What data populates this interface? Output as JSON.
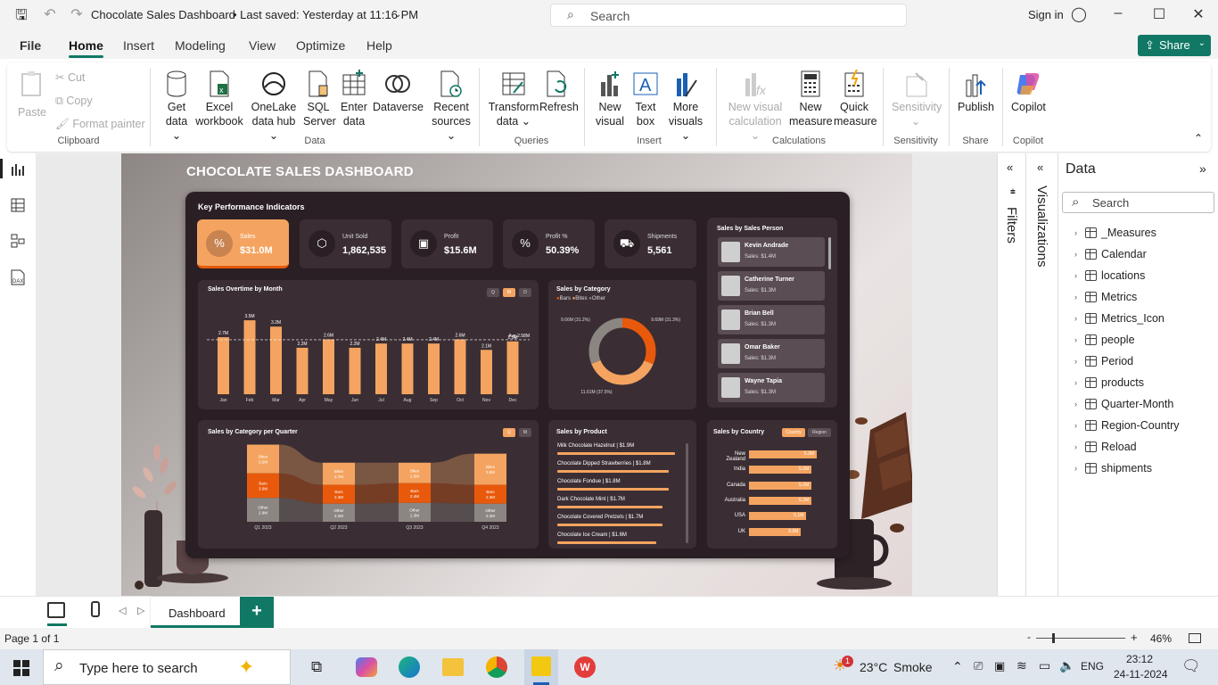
{
  "titlebar": {
    "doc_title": "Chocolate Sales Dashboard",
    "saved": "• Last saved: Yesterday at 11:16 PM",
    "search_placeholder": "Search",
    "sign_in": "Sign in"
  },
  "menu": {
    "file": "File",
    "items": [
      "Home",
      "Insert",
      "Modeling",
      "View",
      "Optimize",
      "Help"
    ],
    "share": "Share"
  },
  "ribbon": {
    "clipboard": {
      "paste": "Paste",
      "cut": "Cut",
      "copy": "Copy",
      "format_painter": "Format painter",
      "group": "Clipboard"
    },
    "data": {
      "get_data": [
        "Get",
        "data ⌄"
      ],
      "excel": [
        "Excel",
        "workbook"
      ],
      "onelake": [
        "OneLake",
        "data hub ⌄"
      ],
      "sql": [
        "SQL",
        "Server"
      ],
      "enter": [
        "Enter",
        "data"
      ],
      "dataverse": [
        "Dataverse",
        ""
      ],
      "recent": [
        "Recent",
        "sources ⌄"
      ],
      "group": "Data"
    },
    "queries": {
      "transform": [
        "Transform",
        "data ⌄"
      ],
      "refresh": [
        "Refresh",
        ""
      ],
      "group": "Queries"
    },
    "insert": {
      "new_visual": [
        "New",
        "visual"
      ],
      "text_box": [
        "Text",
        "box"
      ],
      "more_visuals": [
        "More",
        "visuals ⌄"
      ],
      "group": "Insert"
    },
    "calculations": {
      "new_visual_calc": [
        "New visual",
        "calculation ⌄"
      ],
      "new_measure": [
        "New",
        "measure"
      ],
      "quick_measure": [
        "Quick",
        "measure"
      ],
      "group": "Calculations"
    },
    "sensitivity": {
      "label": [
        "Sensitivity",
        "⌄"
      ],
      "group": "Sensitivity"
    },
    "share": {
      "publish": "Publish",
      "group": "Share"
    },
    "copilot": {
      "label": "Copilot",
      "group": "Copilot"
    }
  },
  "report": {
    "title": "CHOCOLATE SALES DASHBOARD",
    "kpi_title": "Key Performance Indicators",
    "kpis": [
      {
        "label": "Sales",
        "value": "$31.0M",
        "icon": "%"
      },
      {
        "label": "Unit Sold",
        "value": "1,862,535",
        "icon": "⬡"
      },
      {
        "label": "Profit",
        "value": "$15.6M",
        "icon": "▣"
      },
      {
        "label": "Profit %",
        "value": "50.39%",
        "icon": "%"
      },
      {
        "label": "Shipments",
        "value": "5,561",
        "icon": "⛟"
      }
    ],
    "salesperson_title": "Sales by Sales Person",
    "salespersons": [
      {
        "name": "Kevin Andrade",
        "sales": "Sales: $1.4M"
      },
      {
        "name": "Catherine Turner",
        "sales": "Sales: $1.3M"
      },
      {
        "name": "Brian Bell",
        "sales": "Sales: $1.3M"
      },
      {
        "name": "Omar Baker",
        "sales": "Sales: $1.3M"
      },
      {
        "name": "Wayne Tapia",
        "sales": "Sales: $1.3M"
      }
    ],
    "monthly_title": "Sales Overtime by Month",
    "monthly_buttons": [
      "Q",
      "M",
      "D"
    ],
    "avg_label": "Avg 2.58M",
    "category_title": "Sales by Category",
    "category_legend": [
      "Bars",
      "Bites",
      "Other"
    ],
    "quarter_title": "Sales by Category per Quarter",
    "quarter_buttons": [
      "Q",
      "M"
    ],
    "product_title": "Sales by Product",
    "products": [
      {
        "label": "Milk Chocolate Hazelnut | $1.9M",
        "value": 1.9
      },
      {
        "label": "Chocolate Dipped Strawberries | $1.8M",
        "value": 1.8
      },
      {
        "label": "Chocolate Fondue | $1.8M",
        "value": 1.8
      },
      {
        "label": "Dark Chocolate Mint | $1.7M",
        "value": 1.7
      },
      {
        "label": "Chocolate Covered Pretzels | $1.7M",
        "value": 1.7
      },
      {
        "label": "Chocolate Ice Cream | $1.6M",
        "value": 1.6
      }
    ],
    "country_title": "Sales by Country",
    "country_buttons": [
      "Country",
      "Region"
    ],
    "countries": [
      {
        "name": "New Zealand",
        "value": 5.3,
        "label": "5.3M"
      },
      {
        "name": "India",
        "value": 5.2,
        "label": "5.2M"
      },
      {
        "name": "Canada",
        "value": 5.2,
        "label": "5.2M"
      },
      {
        "name": "Australia",
        "value": 5.2,
        "label": "5.2M"
      },
      {
        "name": "USA",
        "value": 5.1,
        "label": "5.1M"
      },
      {
        "name": "UK",
        "value": 5.0,
        "label": "5.0M"
      }
    ]
  },
  "chart_data": [
    {
      "type": "bar",
      "title": "Sales Overtime by Month",
      "categories": [
        "Jan",
        "Feb",
        "Mar",
        "Apr",
        "May",
        "Jun",
        "Jul",
        "Aug",
        "Sep",
        "Oct",
        "Nov",
        "Dec"
      ],
      "values": [
        2.7,
        3.5,
        3.2,
        2.2,
        2.6,
        2.2,
        2.4,
        2.4,
        2.4,
        2.6,
        2.1,
        2.5
      ],
      "labels": [
        "2.7M",
        "3.5M",
        "3.2M",
        "2.2M",
        "2.6M",
        "2.2M",
        "2.4M",
        "2.4M",
        "2.4M",
        "2.6M",
        "2.1M",
        "2.5M"
      ],
      "average": 2.58,
      "ylim": [
        0,
        3.8
      ]
    },
    {
      "type": "pie",
      "title": "Sales by Category",
      "series": [
        {
          "name": "Bars",
          "value": 9.69,
          "label": "9.69M (31.3%)",
          "color": "#e8590c"
        },
        {
          "name": "Bites",
          "value": 11.61,
          "label": "11.61M (37.5%)",
          "color": "#f4a460"
        },
        {
          "name": "Other",
          "value": 9.66,
          "label": "9.66M (31.2%)",
          "color": "#8c8683"
        }
      ]
    },
    {
      "type": "bar",
      "title": "Sales by Category per Quarter",
      "categories": [
        "Q1 2023",
        "Q2 2023",
        "Q3 2023",
        "Q4 2023"
      ],
      "series": [
        {
          "name": "Bites",
          "values": [
            3.5,
            2.7,
            2.5,
            3.8
          ],
          "labels": [
            "3.5M",
            "2.7M",
            "2.5M",
            "3.8M"
          ],
          "color": "#f4a460"
        },
        {
          "name": "Bars",
          "values": [
            3.0,
            2.3,
            2.4,
            2.3
          ],
          "labels": [
            "3.0M",
            "2.3M",
            "2.4M",
            "2.3M"
          ],
          "color": "#e8590c"
        },
        {
          "name": "Other",
          "values": [
            2.9,
            2.2,
            2.3,
            2.2
          ],
          "labels": [
            "2.9M",
            "2.2M",
            "2.3M",
            "2.2M"
          ],
          "color": "#8c8683"
        }
      ]
    }
  ],
  "filters_label": "Filters",
  "viz_label": "Visualizations",
  "data_pane": {
    "title": "Data",
    "search_placeholder": "Search",
    "tables": [
      "_Measures",
      "Calendar",
      "locations",
      "Metrics",
      "Metrics_Icon",
      "people",
      "Period",
      "products",
      "Quarter-Month",
      "Region-Country",
      "Reload",
      "shipments"
    ]
  },
  "tabs": {
    "active": "Dashboard",
    "add": "+"
  },
  "status": {
    "page": "Page 1 of 1",
    "zoom": "46%"
  },
  "taskbar": {
    "search": "Type here to search",
    "weather_temp": "23°C",
    "weather_desc": "Smoke",
    "lang": "ENG",
    "time": "23:12",
    "date": "24-11-2024",
    "badge": "1"
  }
}
